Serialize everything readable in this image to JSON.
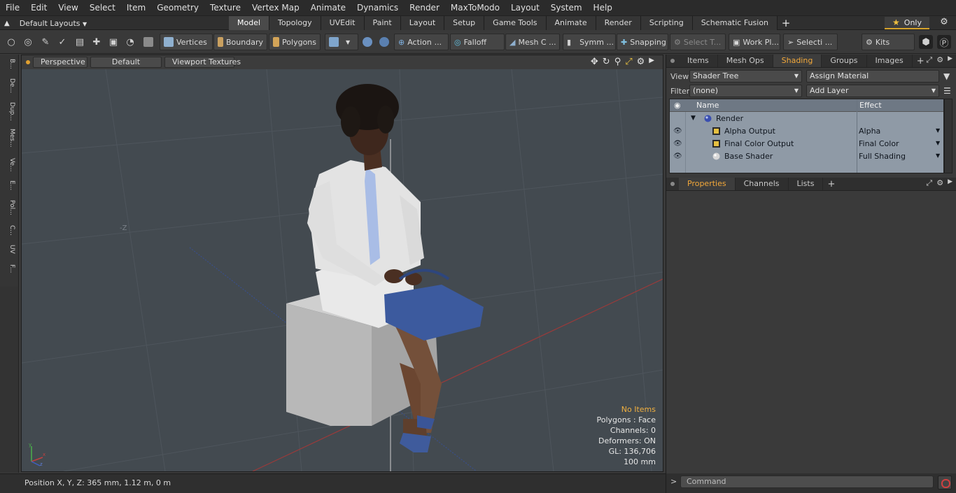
{
  "menubar": {
    "items": [
      "File",
      "Edit",
      "View",
      "Select",
      "Item",
      "Geometry",
      "Texture",
      "Vertex Map",
      "Animate",
      "Dynamics",
      "Render",
      "MaxToModo",
      "Layout",
      "System",
      "Help"
    ]
  },
  "layoutbar": {
    "layout_label": "Default Layouts",
    "tabs": [
      "Model",
      "Topology",
      "UVEdit",
      "Paint",
      "Layout",
      "Setup",
      "Game Tools",
      "Animate",
      "Render",
      "Scripting",
      "Schematic Fusion"
    ],
    "active_tab": "Model",
    "add_label": "+",
    "only_label": "Only"
  },
  "toolbar": {
    "vertices": "Vertices",
    "boundary": "Boundary",
    "polygons": "Polygons",
    "action": "Action",
    "falloff": "Falloff",
    "mesh": "Mesh C ...",
    "symm": "Symm ...",
    "snapping": "Snapping",
    "select_t": "Select T...",
    "work_plane": "Work Pl...",
    "selecti": "Selecti ...",
    "kits": "Kits"
  },
  "left_strip": {
    "tabs": [
      "B...",
      "De...",
      "Dup...",
      "Mes...",
      "Ve...",
      "E...",
      "Pol...",
      "C...",
      "UV",
      "F..."
    ]
  },
  "viewport": {
    "view_mode": "Perspective",
    "style": "Default",
    "textures": "Viewport Textures",
    "axis_label_z": "-Z",
    "hud": {
      "title": "No Items",
      "polygons": "Polygons : Face",
      "channels": "Channels: 0",
      "deformers": "Deformers: ON",
      "gl": "GL: 136,706",
      "scale": "100 mm"
    },
    "gizmo": {
      "x": "x",
      "y": "y",
      "z": "z"
    }
  },
  "statusbar": {
    "position": "Position X, Y, Z:   365 mm, 1.12 m, 0 m"
  },
  "rightpanel": {
    "top_tabs": [
      "Items",
      "Mesh Ops",
      "Shading",
      "Groups",
      "Images"
    ],
    "top_active": "Shading",
    "view_label": "View",
    "view_value": "Shader Tree",
    "assign_material": "Assign Material",
    "filter_label": "Filter",
    "filter_value": "(none)",
    "add_layer": "Add Layer",
    "col_name": "Name",
    "col_effect": "Effect",
    "rows": [
      {
        "name": "Render",
        "effect": ""
      },
      {
        "name": "Alpha Output",
        "effect": "Alpha"
      },
      {
        "name": "Final Color Output",
        "effect": "Final Color"
      },
      {
        "name": "Base Shader",
        "effect": "Full Shading"
      }
    ],
    "bottom_tabs": [
      "Properties",
      "Channels",
      "Lists"
    ],
    "bottom_active": "Properties",
    "command_placeholder": "Command",
    "command_prompt": ">"
  },
  "colors": {
    "accent": "#f2a83a",
    "viewport_bg": "#434a50",
    "table_bg": "#8f9aa6"
  }
}
